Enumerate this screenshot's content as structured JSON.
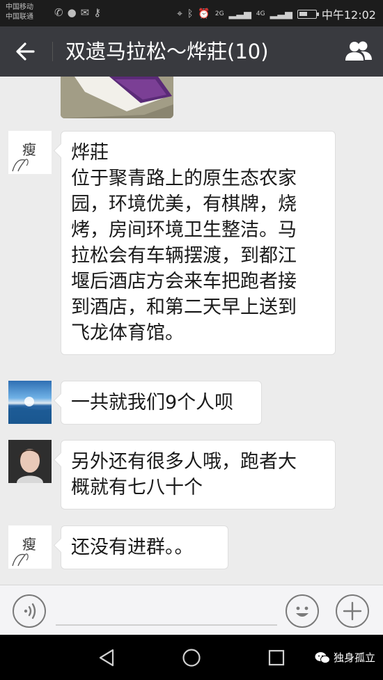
{
  "status_bar": {
    "carrier_1": "中国移动",
    "carrier_2": "中国联通",
    "network_1": "2G",
    "network_2": "4G",
    "battery_level": 0.5,
    "time": "中午12:02"
  },
  "title_bar": {
    "title": "双遗马拉松～烨莊(10)"
  },
  "messages": [
    {
      "type": "image",
      "partial": true
    },
    {
      "type": "text",
      "avatar": "sketch-avatar",
      "sender": "烨莊",
      "lines": [
        "位于聚青路上的原生态农家",
        "园，环境优美，有棋牌，烧",
        "烤，房间环境卫生整洁。马",
        "拉松会有车辆摆渡，到都江",
        "堰后酒店方会来车把跑者接",
        "到酒店，和第二天早上送到",
        "飞龙体育馆。"
      ]
    },
    {
      "type": "text",
      "avatar": "sea-avatar",
      "lines": [
        "一共就我们9个人呗"
      ]
    },
    {
      "type": "text",
      "avatar": "girl-avatar",
      "lines": [
        "另外还有很多人哦，跑者大",
        "概就有七八十个"
      ]
    },
    {
      "type": "text",
      "avatar": "sketch-avatar",
      "lines": [
        "还没有进群。。"
      ]
    }
  ],
  "avatar_glyph": "瘦",
  "watermark": {
    "text": "独身孤立"
  },
  "colors": {
    "title_bar": "#393a3f",
    "chat_bg": "#ececec",
    "bubble": "#ffffff",
    "status_bar": "#1c1c1c"
  }
}
